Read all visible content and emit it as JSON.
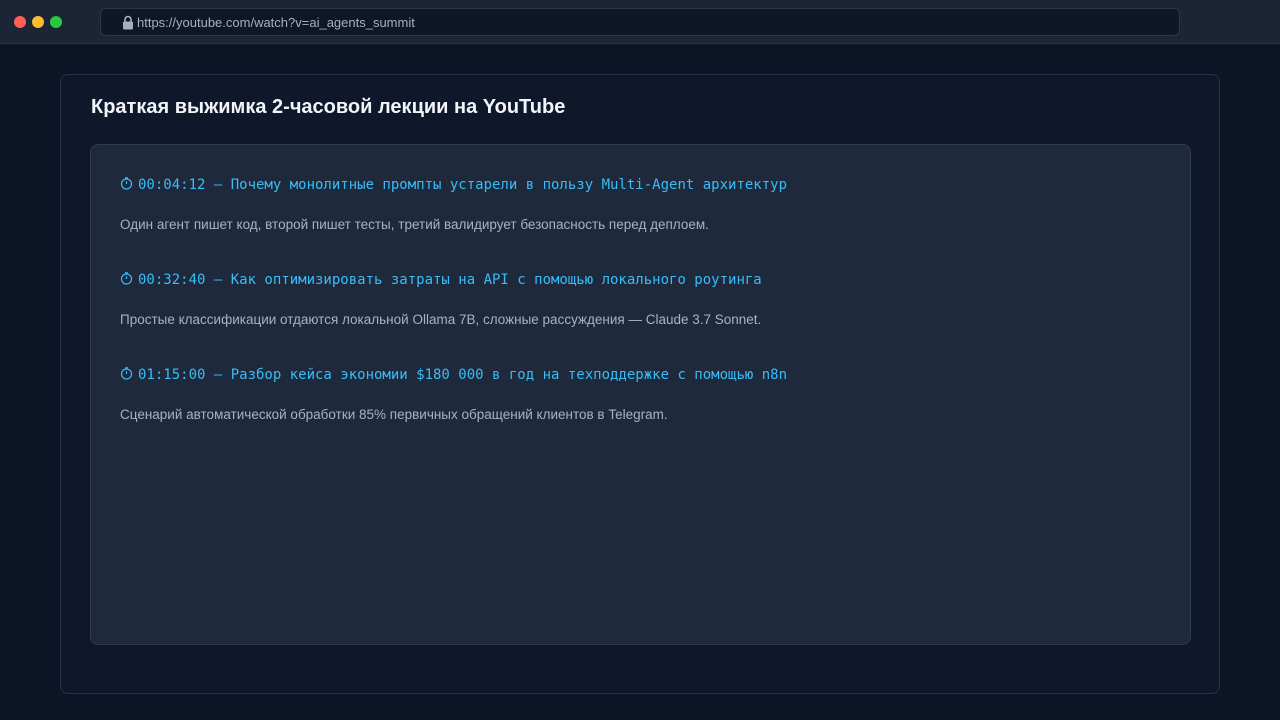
{
  "browser": {
    "url": "https://youtube.com/watch?v=ai_agents_summit"
  },
  "page": {
    "title": "Краткая выжимка 2-часовой лекции на YouTube"
  },
  "chapters": [
    {
      "icon": "clock-icon",
      "timestamp": "00:04:12",
      "title": "Почему монолитные промпты устарели в пользу Multi-Agent архитектур",
      "heading": "00:04:12 — Почему монолитные промпты устарели в пользу Multi-Agent архитектур",
      "description": "Один агент пишет код, второй пишет тесты, третий валидирует безопасность перед деплоем."
    },
    {
      "icon": "clock-icon",
      "timestamp": "00:32:40",
      "title": "Как оптимизировать затраты на API с помощью локального роутинга",
      "heading": "00:32:40 — Как оптимизировать затраты на API с помощью локального роутинга",
      "description": "Простые классификации отдаются локальной Ollama 7B, сложные рассуждения — Claude 3.7 Sonnet."
    },
    {
      "icon": "clock-icon",
      "timestamp": "01:15:00",
      "title": "Разбор кейса экономии $180 000 в год на техподдержке с помощью n8n",
      "heading": "01:15:00 — Разбор кейса экономии $180 000 в год на техподдержке с помощью n8n",
      "description": "Сценарий автоматической обработки 85% первичных обращений клиентов в Telegram."
    }
  ],
  "colors": {
    "accent": "#38bdf8",
    "background": "#0c1426",
    "panel": "#0f172a",
    "card": "#1e293b",
    "text_primary": "#f1f5f9",
    "text_secondary": "#a8b2c1"
  }
}
